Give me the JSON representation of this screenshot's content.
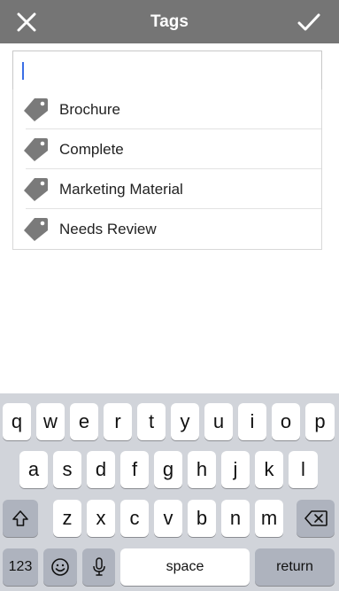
{
  "header": {
    "title": "Tags",
    "close_icon": "close-icon",
    "done_icon": "checkmark-icon"
  },
  "search": {
    "value": "",
    "placeholder": ""
  },
  "tags": [
    {
      "label": "Brochure",
      "icon": "tag-icon"
    },
    {
      "label": "Complete",
      "icon": "tag-icon"
    },
    {
      "label": "Marketing Material",
      "icon": "tag-icon"
    },
    {
      "label": "Needs Review",
      "icon": "tag-icon"
    }
  ],
  "keyboard": {
    "row1": [
      "q",
      "w",
      "e",
      "r",
      "t",
      "y",
      "u",
      "i",
      "o",
      "p"
    ],
    "row2": [
      "a",
      "s",
      "d",
      "f",
      "g",
      "h",
      "j",
      "k",
      "l"
    ],
    "row3": [
      "z",
      "x",
      "c",
      "v",
      "b",
      "n",
      "m"
    ],
    "numbers_label": "123",
    "space_label": "space",
    "return_label": "return",
    "icons": {
      "shift": "shift-icon",
      "delete": "backspace-icon",
      "emoji": "emoji-icon",
      "mic": "microphone-icon"
    }
  },
  "colors": {
    "header_bg": "#757575",
    "keyboard_bg": "#d1d4da",
    "tag_icon": "#7a7a7a",
    "caret": "#3b6ee6"
  }
}
